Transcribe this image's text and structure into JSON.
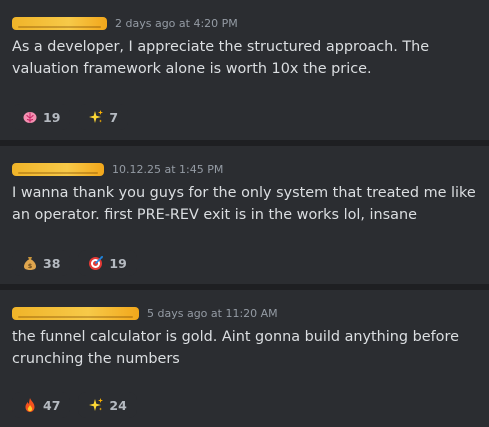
{
  "comments": [
    {
      "timestamp": "2 days ago at 4:20 PM",
      "text": "As a developer, I appreciate the structured approach. The valuation framework alone is worth 10x the price.",
      "reactions": [
        {
          "icon": "brain-icon",
          "count": "19"
        },
        {
          "icon": "sparkles-icon",
          "count": "7"
        }
      ]
    },
    {
      "timestamp": "10.12.25 at 1:45 PM",
      "text": "I wanna thank you guys for the only system that treated me like an operator. first PRE-REV exit is in the works lol, insane",
      "reactions": [
        {
          "icon": "money-bag-icon",
          "count": "38"
        },
        {
          "icon": "direct-hit-icon",
          "count": "19"
        }
      ]
    },
    {
      "timestamp": "5 days ago at 11:20 AM",
      "text": "the funnel calculator is gold. Aint gonna build anything before crunching the numbers",
      "reactions": [
        {
          "icon": "fire-icon",
          "count": "47"
        },
        {
          "icon": "sparkles-icon",
          "count": "24"
        }
      ]
    }
  ],
  "colors": {
    "background": "#1e1f22",
    "card": "#2b2d31",
    "text": "#dbdee1",
    "muted": "#949ba4",
    "redaction": "#f7c948"
  }
}
